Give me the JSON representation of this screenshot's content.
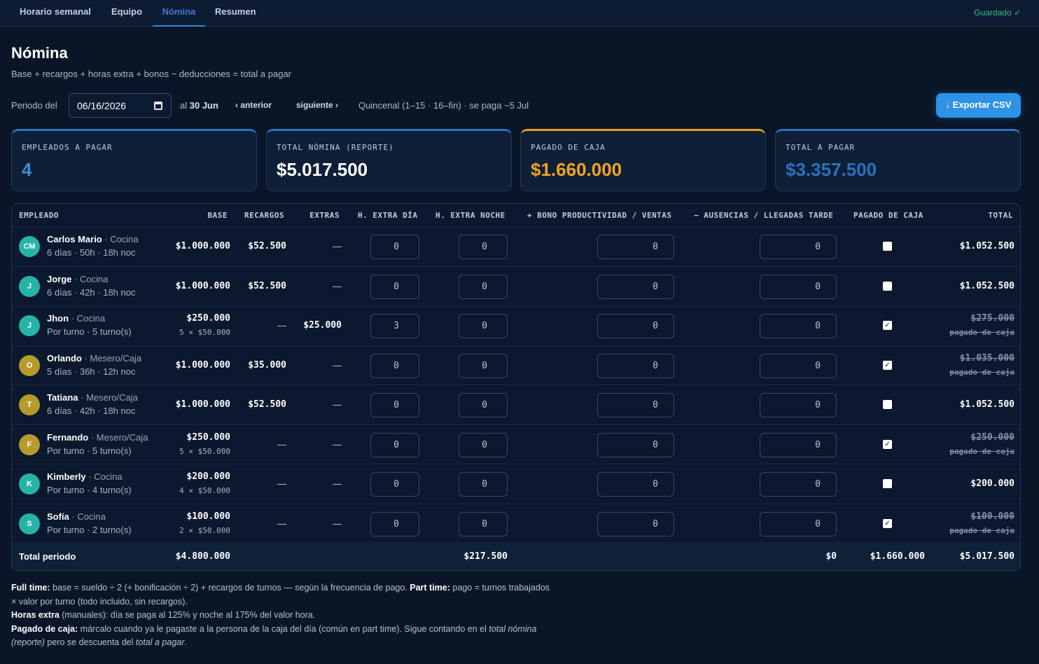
{
  "nav": {
    "tabs": [
      "Horario semanal",
      "Equipo",
      "Nómina",
      "Resumen"
    ],
    "active": "Nómina",
    "status": "Guardado ✓"
  },
  "page": {
    "title": "Nómina",
    "subtitle": "Base + recargos + horas extra + bonos − deducciones = total a pagar"
  },
  "period": {
    "label": "Periodo del",
    "date_value": "06/16/2026",
    "to_label": "al",
    "to_value": "30 Jun",
    "prev": "‹ anterior",
    "next": "siguiente ›",
    "info": "Quincenal (1–15 · 16–fin) · se paga ~5 Jul",
    "export": "↓ Exportar CSV"
  },
  "cards": [
    {
      "label": "EMPLEADOS A PAGAR",
      "value": "4"
    },
    {
      "label": "TOTAL NÓMINA (REPORTE)",
      "value": "$5.017.500"
    },
    {
      "label": "PAGADO DE CAJA",
      "value": "$1.660.000"
    },
    {
      "label": "TOTAL A PAGAR",
      "value": "$3.357.500"
    }
  ],
  "colors": {
    "accent": "#2e92e6",
    "gold": "#f2a51e",
    "success": "#2ec27e"
  },
  "table": {
    "headers": [
      "EMPLEADO",
      "BASE",
      "RECARGOS",
      "EXTRAS",
      "H. EXTRA DÍA",
      "H. EXTRA NOCHE",
      "+ BONO PRODUCTIVIDAD / VENTAS",
      "− AUSENCIAS / LLEGADAS TARDE",
      "PAGADO DE CAJA",
      "TOTAL"
    ],
    "rows": [
      {
        "initials": "CM",
        "color": "#26b3a8",
        "name": "Carlos Mario",
        "role": " · Cocina",
        "detail": "6 días · 50h · 18h noc",
        "base": "$1.000.000",
        "base_sub": "",
        "recargos": "$52.500",
        "extras": "—",
        "hdia": "0",
        "hnoche": "0",
        "bono": "0",
        "ausencias": "0",
        "paid": false,
        "total": "$1.052.500",
        "paid_note": ""
      },
      {
        "initials": "J",
        "color": "#26b3a8",
        "name": "Jorge",
        "role": " · Cocina",
        "detail": "6 días · 42h · 18h noc",
        "base": "$1.000.000",
        "base_sub": "",
        "recargos": "$52.500",
        "extras": "—",
        "hdia": "0",
        "hnoche": "0",
        "bono": "0",
        "ausencias": "0",
        "paid": false,
        "total": "$1.052.500",
        "paid_note": ""
      },
      {
        "initials": "J",
        "color": "#26b3a8",
        "name": "Jhon",
        "role": " · Cocina",
        "detail": "Por turno · 5 turno(s)",
        "base": "$250.000",
        "base_sub": "5 × $50.000",
        "recargos": "—",
        "extras": "$25.000",
        "hdia": "3",
        "hnoche": "0",
        "bono": "0",
        "ausencias": "0",
        "paid": true,
        "total": "$275.000",
        "paid_note": "pagado de caja"
      },
      {
        "initials": "O",
        "color": "#b59a2c",
        "name": "Orlando",
        "role": " · Mesero/Caja",
        "detail": "5 días · 36h · 12h noc",
        "base": "$1.000.000",
        "base_sub": "",
        "recargos": "$35.000",
        "extras": "—",
        "hdia": "0",
        "hnoche": "0",
        "bono": "0",
        "ausencias": "0",
        "paid": true,
        "total": "$1.035.000",
        "paid_note": "pagado de caja"
      },
      {
        "initials": "T",
        "color": "#b59a2c",
        "name": "Tatiana",
        "role": " · Mesero/Caja",
        "detail": "6 días · 42h · 18h noc",
        "base": "$1.000.000",
        "base_sub": "",
        "recargos": "$52.500",
        "extras": "—",
        "hdia": "0",
        "hnoche": "0",
        "bono": "0",
        "ausencias": "0",
        "paid": false,
        "total": "$1.052.500",
        "paid_note": ""
      },
      {
        "initials": "F",
        "color": "#b59a2c",
        "name": "Fernando",
        "role": " · Mesero/Caja",
        "detail": "Por turno · 5 turno(s)",
        "base": "$250.000",
        "base_sub": "5 × $50.000",
        "recargos": "—",
        "extras": "—",
        "hdia": "0",
        "hnoche": "0",
        "bono": "0",
        "ausencias": "0",
        "paid": true,
        "total": "$250.000",
        "paid_note": "pagado de caja"
      },
      {
        "initials": "K",
        "color": "#26b3a8",
        "name": "Kimberly",
        "role": " · Cocina",
        "detail": "Por turno · 4 turno(s)",
        "base": "$200.000",
        "base_sub": "4 × $50.000",
        "recargos": "—",
        "extras": "—",
        "hdia": "0",
        "hnoche": "0",
        "bono": "0",
        "ausencias": "0",
        "paid": false,
        "total": "$200.000",
        "paid_note": ""
      },
      {
        "initials": "S",
        "color": "#26b3a8",
        "name": "Sofía",
        "role": " · Cocina",
        "detail": "Por turno · 2 turno(s)",
        "base": "$100.000",
        "base_sub": "2 × $50.000",
        "recargos": "—",
        "extras": "—",
        "hdia": "0",
        "hnoche": "0",
        "bono": "0",
        "ausencias": "0",
        "paid": true,
        "total": "$100.000",
        "paid_note": "pagado de caja"
      }
    ],
    "footer": {
      "label": "Total periodo",
      "base": "$4.800.000",
      "recargos_total": "$217.500",
      "deductions": "$0",
      "paid": "$1.660.000",
      "total": "$5.017.500"
    }
  },
  "notes": {
    "l1_b": "Full time:",
    "l1": " base = sueldo ÷ 2 (+ bonificación ÷ 2) + recargos de turnos — según la frecuencia de pago. ",
    "l1_b2": "Part time:",
    "l1_2": " pago = turnos trabajados × valor por turno (todo incluido, sin recargos).",
    "l2_b": "Horas extra",
    "l2": " (manuales): día se paga al 125% y noche al 175% del valor hora.",
    "l3_b": "Pagado de caja:",
    "l3": " márcalo cuando ya le pagaste a la persona de la caja del día (común en part time). Sigue contando en el ",
    "l3_i": "total nómina (reporte)",
    "l3_2": " pero se descuenta del ",
    "l3_i2": "total a pagar",
    "l3_3": "."
  }
}
